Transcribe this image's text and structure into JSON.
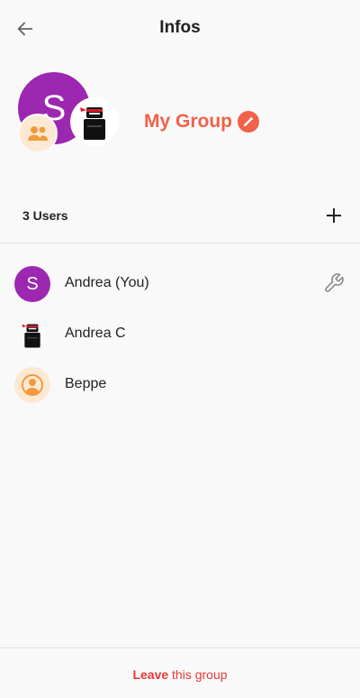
{
  "header": {
    "title": "Infos",
    "back_icon": "arrow-left-icon"
  },
  "group": {
    "avatar_letter": "S",
    "avatar_color": "#9c27b0",
    "name": "My Group",
    "name_color": "#f2614a",
    "edit_icon": "pencil-icon",
    "badge_icon": "people-icon"
  },
  "users": {
    "count_label": "3 Users",
    "add_icon": "plus-icon",
    "list": [
      {
        "name": "Andrea (You)",
        "avatar": "S",
        "avatar_color": "#9c27b0",
        "admin_icon": "wrench-icon"
      },
      {
        "name": "Andrea C",
        "avatar_icon": "ninja-icon"
      },
      {
        "name": "Beppe",
        "avatar_icon": "person-icon",
        "avatar_color": "#fde9d3"
      }
    ]
  },
  "footer": {
    "leave_label": "Leave",
    "leave_rest": " this group",
    "leave_color": "#e53935"
  }
}
